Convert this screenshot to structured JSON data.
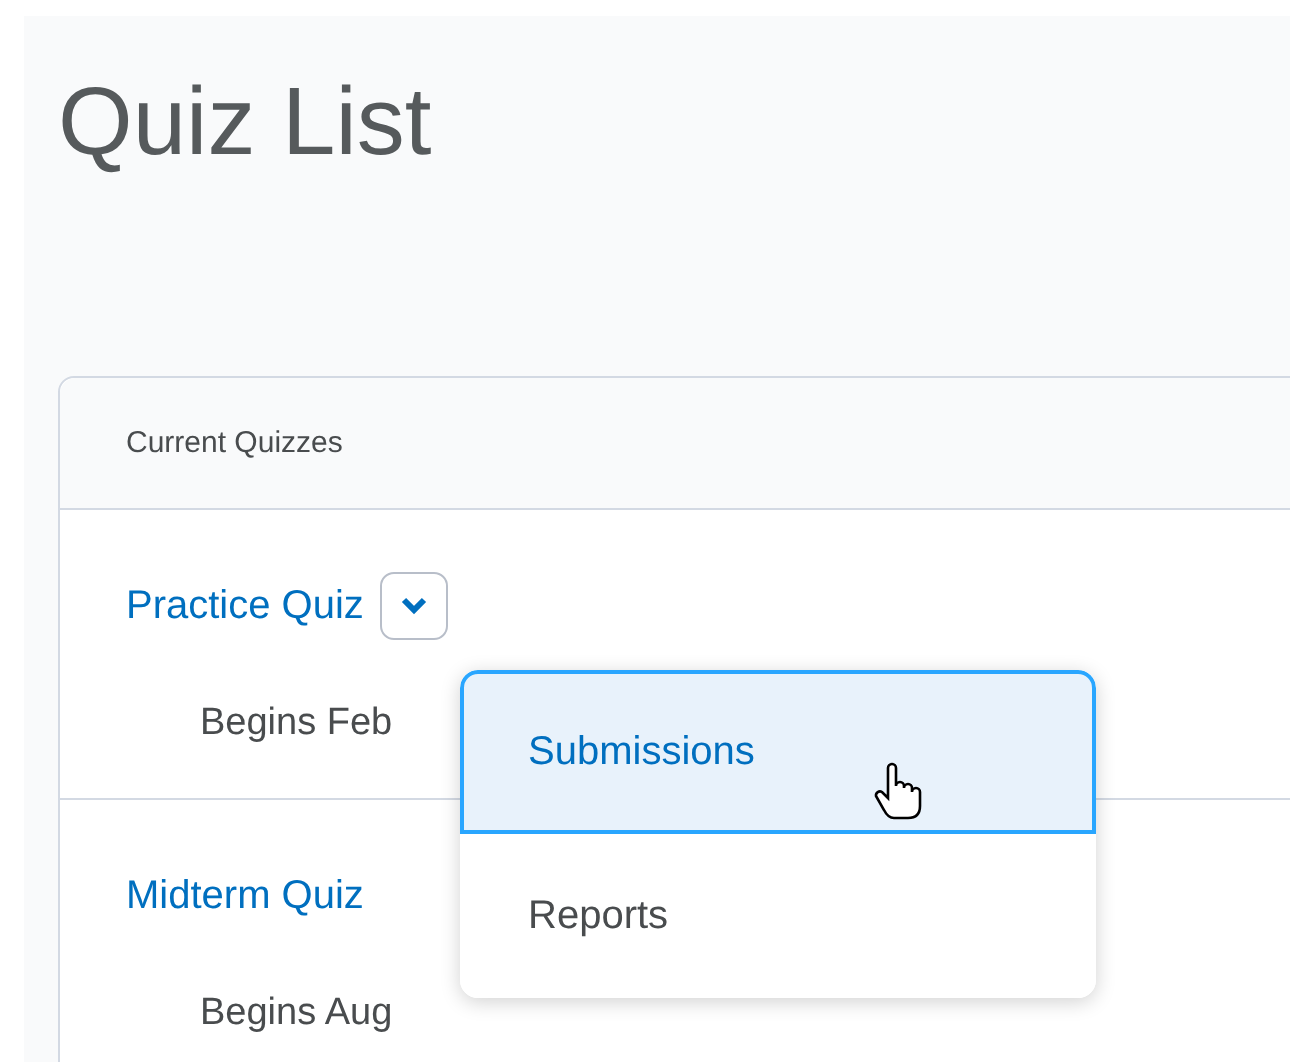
{
  "page_title": "Quiz List",
  "table": {
    "header": "Current Quizzes",
    "rows": [
      {
        "name": "Practice Quiz",
        "date": "Begins Feb",
        "menu_open": true
      },
      {
        "name": "Midterm Quiz",
        "date": "Begins Aug",
        "menu_open": false
      }
    ]
  },
  "context_menu": {
    "items": [
      {
        "label": "Submissions",
        "selected": true
      },
      {
        "label": "Reports",
        "selected": false
      }
    ]
  }
}
